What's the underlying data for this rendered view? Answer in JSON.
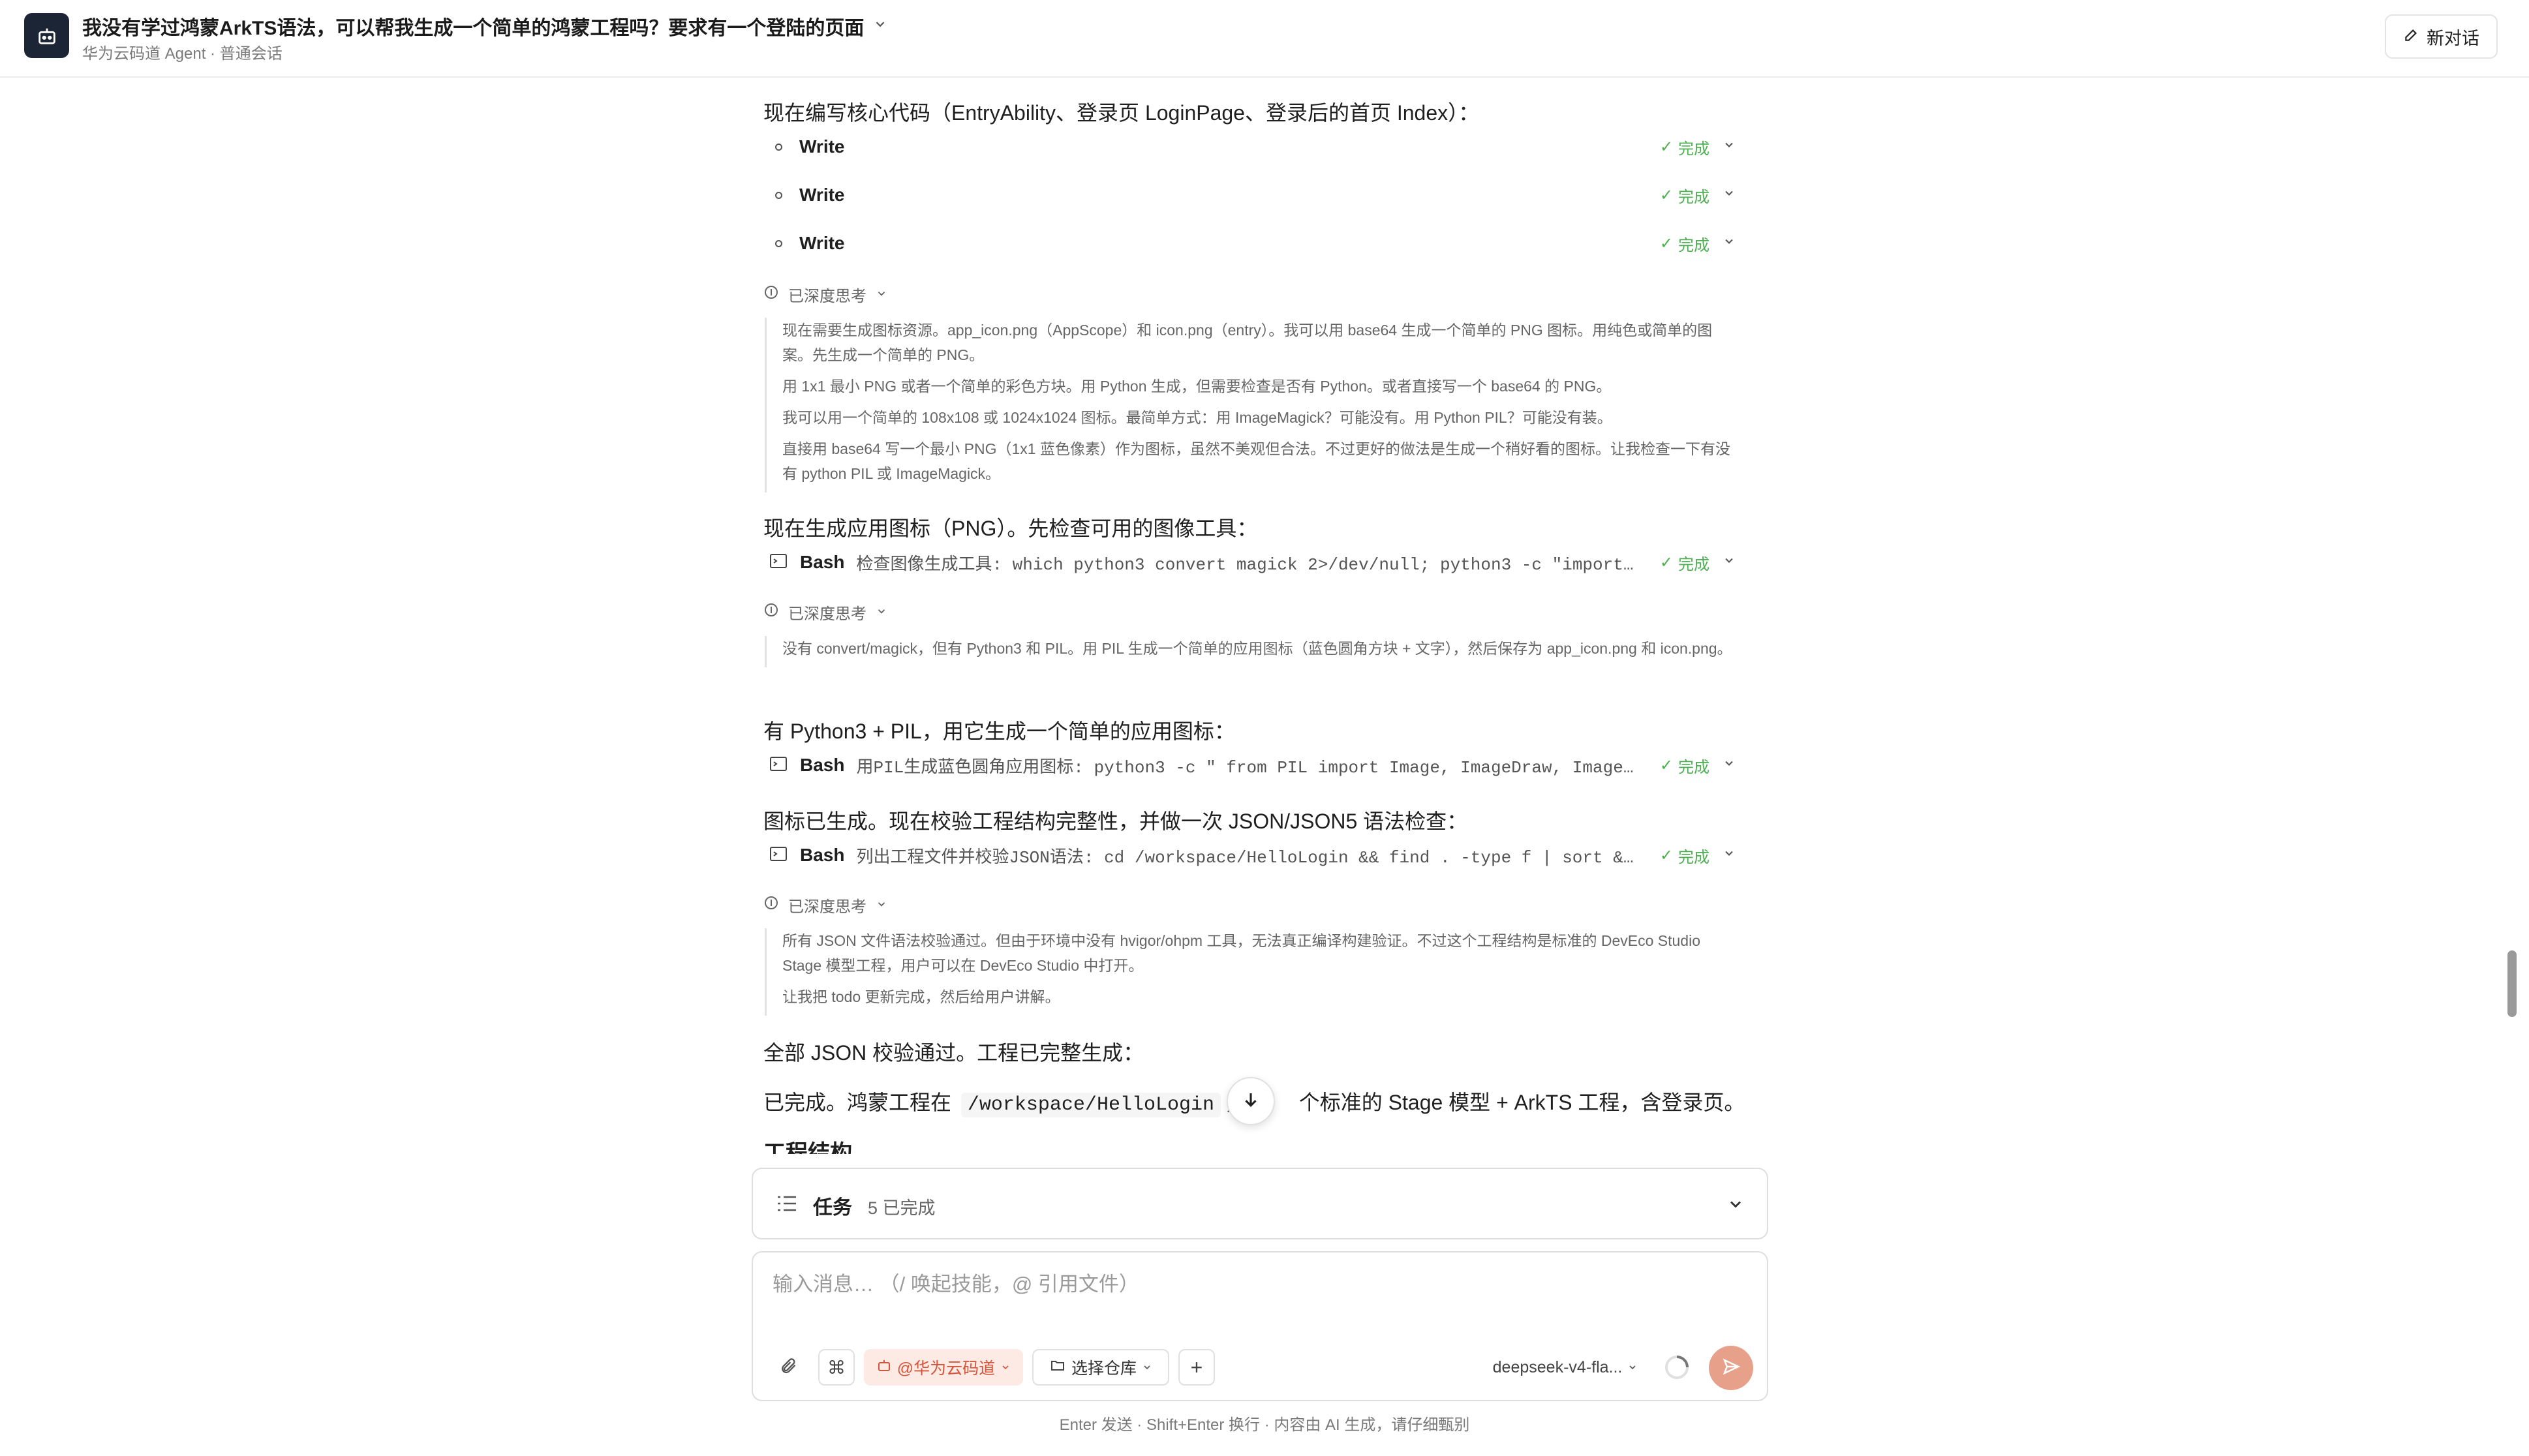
{
  "header": {
    "title": "我没有学过鸿蒙ArkTS语法，可以帮我生成一个简单的鸿蒙工程吗？要求有一个登陆的页面",
    "subtitle": "华为云码道 Agent · 普通会话",
    "new_chat_label": "新对话"
  },
  "messages": {
    "intro": "现在编写核心代码（EntryAbility、登录页 LoginPage、登录后的首页 Index）：",
    "writes": [
      {
        "name": "Write",
        "status": "完成"
      },
      {
        "name": "Write",
        "status": "完成"
      },
      {
        "name": "Write",
        "status": "完成"
      }
    ],
    "think1": {
      "label": "已深度思考",
      "lines": [
        "现在需要生成图标资源。app_icon.png（AppScope）和 icon.png（entry）。我可以用 base64 生成一个简单的 PNG 图标。用纯色或简单的图案。先生成一个简单的 PNG。",
        "用 1x1 最小 PNG 或者一个简单的彩色方块。用 Python 生成，但需要检查是否有 Python。或者直接写一个 base64 的 PNG。",
        "我可以用一个简单的 108x108 或 1024x1024 图标。最简单方式：用 ImageMagick？可能没有。用 Python PIL？可能没有装。",
        "直接用 base64 写一个最小 PNG（1x1 蓝色像素）作为图标，虽然不美观但合法。不过更好的做法是生成一个稍好看的图标。让我检查一下有没有 python PIL 或 ImageMagick。"
      ]
    },
    "para2": "现在生成应用图标（PNG）。先检查可用的图像工具：",
    "bash1": {
      "name": "Bash",
      "desc": "检查图像生成工具: which python3 convert magick 2>/dev/null; python3 -c \"import…",
      "status": "完成"
    },
    "think2": {
      "label": "已深度思考",
      "lines": [
        "没有 convert/magick，但有 Python3 和 PIL。用 PIL 生成一个简单的应用图标（蓝色圆角方块 + 文字），然后保存为 app_icon.png 和 icon.png。"
      ]
    },
    "para3": "有 Python3 + PIL，用它生成一个简单的应用图标：",
    "bash2": {
      "name": "Bash",
      "desc": "用PIL生成蓝色圆角应用图标: python3 -c \" from PIL import Image, ImageDraw, Image…",
      "status": "完成"
    },
    "para4": "图标已生成。现在校验工程结构完整性，并做一次 JSON/JSON5 语法检查：",
    "bash3": {
      "name": "Bash",
      "desc": "列出工程文件并校验JSON语法: cd /workspace/HelloLogin && find . -type f | sort &…",
      "status": "完成"
    },
    "think3": {
      "label": "已深度思考",
      "lines": [
        "所有 JSON 文件语法校验通过。但由于环境中没有 hvigor/ohpm 工具，无法真正编译构建验证。不过这个工程结构是标准的 DevEco Studio Stage 模型工程，用户可以在 DevEco Studio 中打开。",
        "让我把 todo 更新完成，然后给用户讲解。"
      ]
    },
    "para5": "全部 JSON 校验通过。工程已完整生成：",
    "para6": {
      "prefix": "已完成。鸿蒙工程在",
      "path": "/workspace/HelloLogin",
      "suffix": "，",
      "suffix2": "个标准的 Stage 模型 + ArkTS 工程，含登录页。"
    },
    "para7": "工程结构"
  },
  "tasks": {
    "label": "任务",
    "count": "5 已完成"
  },
  "composer": {
    "placeholder": "输入消息… （/ 唤起技能，@ 引用文件）",
    "agent_chip": "@华为云码道",
    "repo_chip": "选择仓库",
    "model": "deepseek-v4-fla..."
  },
  "footer_note": "Enter 发送 · Shift+Enter 换行 · 内容由 AI 生成，请仔细甄别"
}
